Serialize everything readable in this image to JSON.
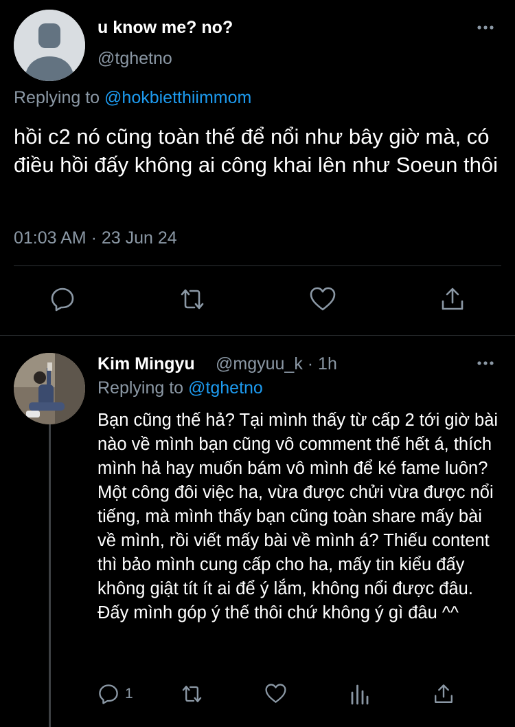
{
  "main_tweet": {
    "display_name": "u know me? no?",
    "handle": "@tghetno",
    "replying_prefix": "Replying to ",
    "replying_to": "@hokbietthiimmom",
    "text": "hồi c2 nó cũng toàn thế để nổi như bây giờ mà, có điều hồi đấy không ai công khai lên như Soeun thôi",
    "timestamp": "01:03 AM · 23 Jun 24",
    "avatar_icon": "default-profile-icon",
    "actions": [
      "reply-icon",
      "retweet-icon",
      "like-icon",
      "share-icon"
    ]
  },
  "reply_tweet": {
    "display_name": "Kim Mingyu",
    "handle_time": "@mgyuu_k · 1h",
    "replying_prefix": "Replying to ",
    "replying_to": "@tghetno",
    "text": "Bạn cũng thế hả? Tại mình thấy từ cấp 2 tới giờ bài nào về mình bạn cũng vô comment thế hết á, thích mình hả hay muốn bám vô mình để ké fame luôn? Một công đôi việc ha, vừa được chửi vừa được nổi tiếng, mà mình thấy bạn cũng toàn share mấy bài về mình, rồi viết mấy bài về mình á? Thiếu content thì bảo mình cung cấp cho ha, mấy tin kiểu đấy không giật tít ít ai để ý lắm, không nổi được đâu. Đấy mình góp ý thế thôi chứ không ý gì đâu ^^",
    "reply_count": "1",
    "actions": [
      "reply-icon",
      "retweet-icon",
      "like-icon",
      "analytics-icon",
      "share-icon"
    ]
  },
  "colors": {
    "background": "#000000",
    "text": "#ffffff",
    "secondary": "#8b98a5",
    "link": "#1d9bf0",
    "divider": "#2f3336"
  }
}
